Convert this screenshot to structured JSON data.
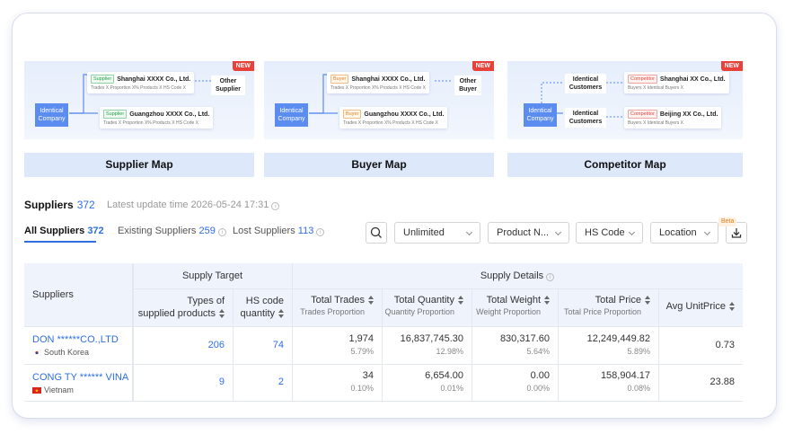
{
  "maps": [
    {
      "caption": "Supplier Map",
      "badge": "NEW",
      "identical": "Identical Company",
      "other": "Other Supplier",
      "entities": [
        {
          "tag": "Supplier",
          "name": "Shanghai XXXX Co., Ltd.",
          "sub": "Trades X  Proportion X%  Products X  HS Code X"
        },
        {
          "tag": "Supplier",
          "name": "Guangzhou XXXX Co., Ltd.",
          "sub": "Trades X  Proportion X%  Products X  HS Code X"
        }
      ]
    },
    {
      "caption": "Buyer Map",
      "badge": "NEW",
      "identical": "Identical Company",
      "other": "Other Buyer",
      "entities": [
        {
          "tag": "Buyer",
          "name": "Shanghai XXXX Co., Ltd.",
          "sub": "Trades X  Proportion X%  Products X  HS Code X"
        },
        {
          "tag": "Buyer",
          "name": "Guangzhou XXXX Co., Ltd.",
          "sub": "Trades X  Proportion X%  Products X  HS Code X"
        }
      ]
    },
    {
      "caption": "Competitor Map",
      "badge": "NEW",
      "identical": "Identical Company",
      "identical_customers": "Identical Customers",
      "entities": [
        {
          "tag": "Competitor",
          "name": "Shanghai XX Co., Ltd.",
          "sub": "Buyers X  Identical Buyers X"
        },
        {
          "tag": "Competitor",
          "name": "Beijing XX Co., Ltd.",
          "sub": "Buyers X  Identical Buyers X"
        }
      ]
    }
  ],
  "suppliers": {
    "title": "Suppliers",
    "count": "372",
    "update_text": "Latest update time 2026-05-24 17:31"
  },
  "tabs": {
    "all": {
      "label": "All Suppliers",
      "count": "372"
    },
    "existing": {
      "label": "Existing Suppliers",
      "count": "259"
    },
    "lost": {
      "label": "Lost Suppliers",
      "count": "113"
    }
  },
  "filters": {
    "time": "Unlimited",
    "product": "Product N...",
    "hs_code": "HS Code",
    "location": "Location",
    "beta": "Beta"
  },
  "table": {
    "headers": {
      "suppliers": "Suppliers",
      "supply_target": "Supply Target",
      "supply_details": "Supply Details",
      "types": "Types of supplied products",
      "types_line1": "Types of",
      "types_line2": "supplied products",
      "hs_line1": "HS code",
      "hs_line2": "quantity",
      "total_trades": "Total Trades",
      "trades_prop": "Trades Proportion",
      "total_quantity": "Total Quantity",
      "quantity_prop": "Quantity Proportion",
      "total_weight": "Total Weight",
      "weight_prop": "Weight Proportion",
      "total_price": "Total Price",
      "price_prop": "Total Price Proportion",
      "avg_price": "Avg UnitPrice"
    },
    "rows": [
      {
        "name": "DON ******CO.,LTD",
        "country": "South Korea",
        "types": "206",
        "hs": "74",
        "trades": "1,974",
        "trades_pct": "5.79%",
        "quantity": "16,837,745.30",
        "quantity_pct": "12.98%",
        "weight": "830,317.60",
        "weight_pct": "5.64%",
        "price": "12,249,449.82",
        "price_pct": "5.89%",
        "avg": "0.73"
      },
      {
        "name": "CONG TY ****** VINA",
        "country": "Vietnam",
        "types": "9",
        "hs": "2",
        "trades": "34",
        "trades_pct": "0.10%",
        "quantity": "6,654.00",
        "quantity_pct": "0.01%",
        "weight": "0.00",
        "weight_pct": "0.00%",
        "price": "158,904.17",
        "price_pct": "0.08%",
        "avg": "23.88"
      }
    ]
  },
  "colors": {
    "accent": "#2f6fe0",
    "header_bg": "#eef3fc",
    "badge": "#e8413a"
  }
}
